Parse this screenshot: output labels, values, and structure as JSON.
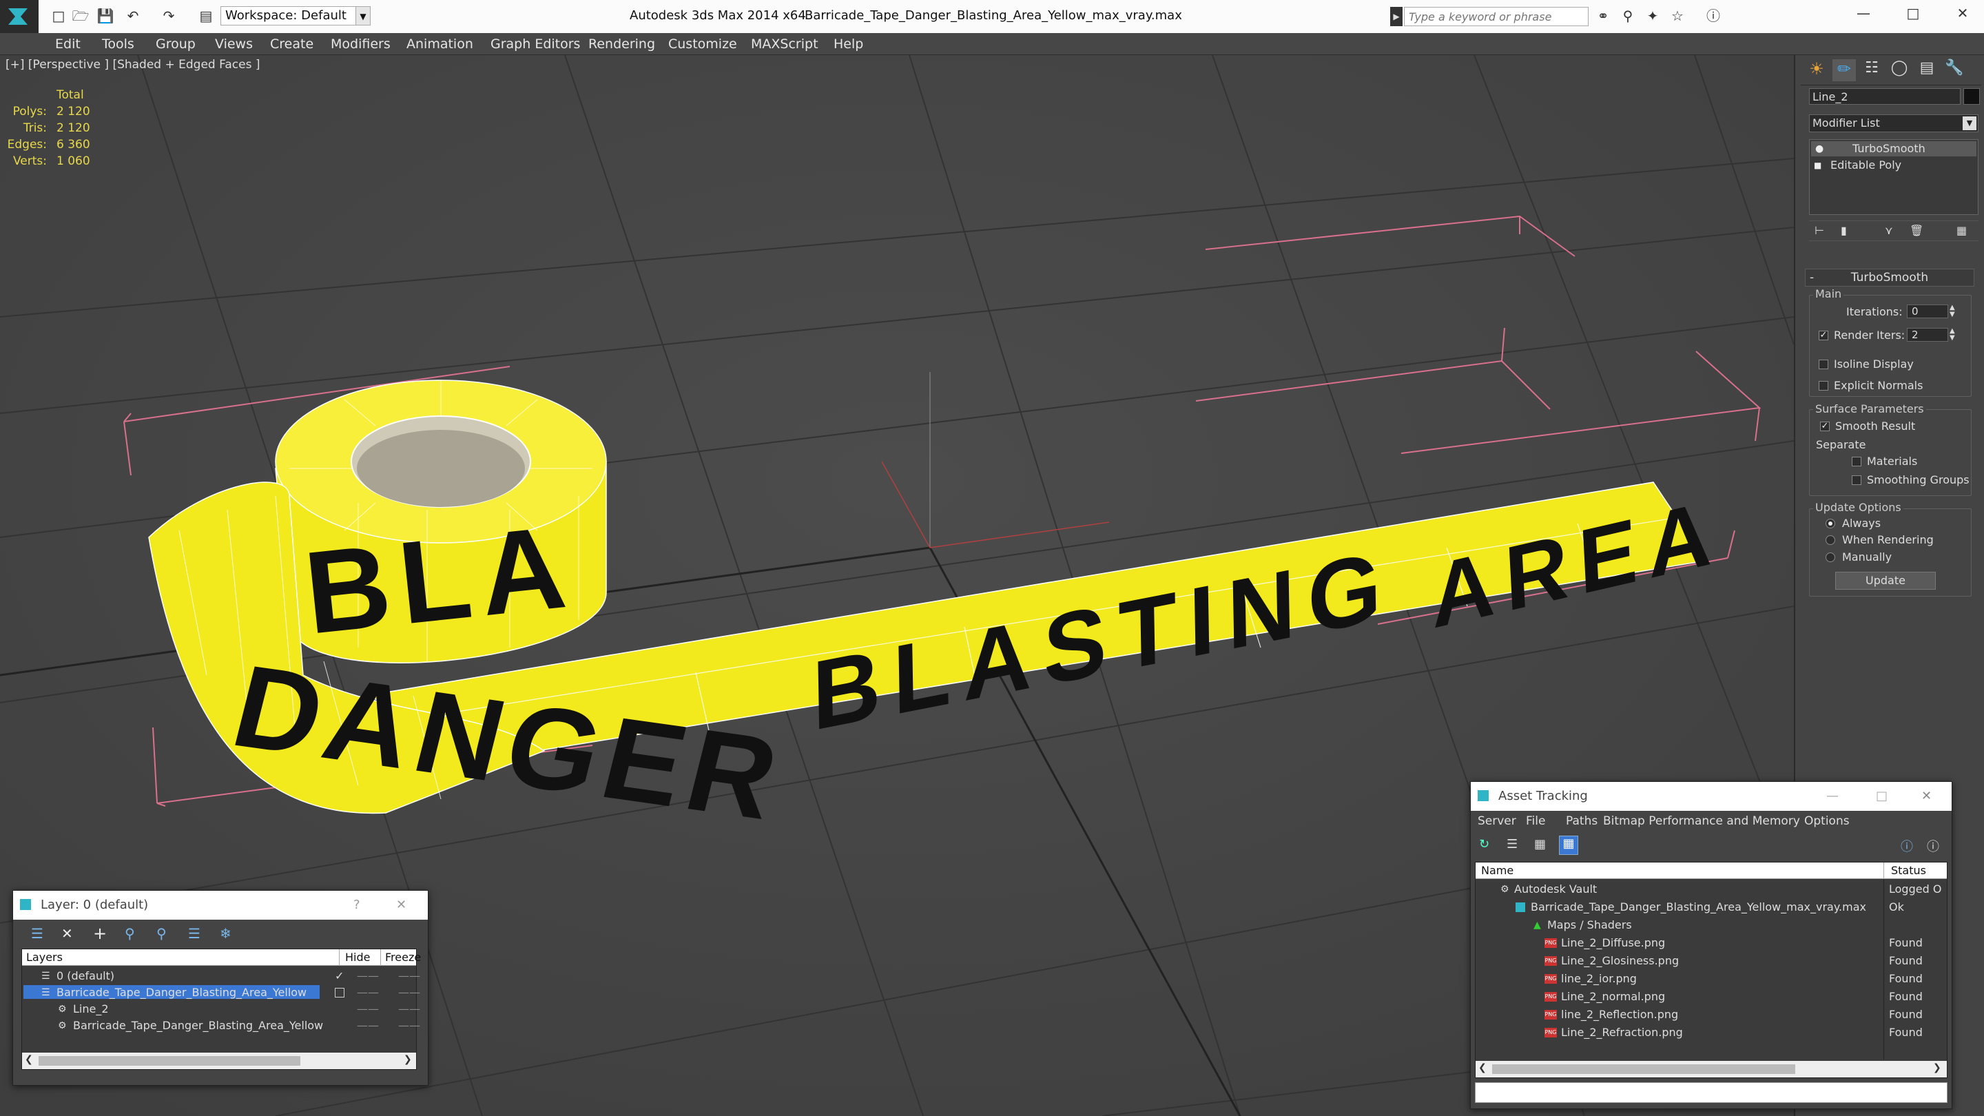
{
  "titlebar": {
    "workspace": "Workspace: Default",
    "app_title": "Autodesk 3ds Max  2014 x64",
    "file_title": "Barricade_Tape_Danger_Blasting_Area_Yellow_max_vray.max",
    "search_placeholder": "Type a keyword or phrase"
  },
  "menu": [
    "Edit",
    "Tools",
    "Group",
    "Views",
    "Create",
    "Modifiers",
    "Animation",
    "Graph Editors",
    "Rendering",
    "Customize",
    "MAXScript",
    "Help"
  ],
  "viewport": {
    "label": "[+] [Perspective ] [Shaded + Edged Faces ]",
    "stats_header": "Total",
    "stats": [
      {
        "label": "Polys:",
        "value": "2 120"
      },
      {
        "label": "Tris:",
        "value": "2 120"
      },
      {
        "label": "Edges:",
        "value": "6 360"
      },
      {
        "label": "Verts:",
        "value": "1 060"
      }
    ],
    "tape_text": [
      "DANGER",
      "BLASTING",
      "AREA"
    ],
    "roll_text": "BLA",
    "colors": {
      "tape_yellow": "#f2ea1c",
      "text_black": "#111111",
      "bbox_pink": "#d9708c",
      "grid": "#3b3b3b"
    }
  },
  "command_panel": {
    "object_name": "Line_2",
    "modifier_list": "Modifier List",
    "stack": [
      "TurboSmooth",
      "Editable Poly"
    ],
    "turbosmooth": {
      "title": "TurboSmooth",
      "main_label": "Main",
      "iterations_label": "Iterations:",
      "iterations_value": "0",
      "render_iters_label": "Render Iters:",
      "render_iters_value": "2",
      "render_iters_checked": true,
      "isoline_label": "Isoline Display",
      "explicit_normals_label": "Explicit Normals",
      "surface_label": "Surface Parameters",
      "smooth_result_label": "Smooth Result",
      "separate_label": "Separate",
      "materials_label": "Materials",
      "smoothing_groups_label": "Smoothing Groups",
      "update_options_label": "Update Options",
      "always_label": "Always",
      "when_rendering_label": "When Rendering",
      "manually_label": "Manually",
      "update_button": "Update"
    }
  },
  "layer_window": {
    "title": "Layer: 0 (default)",
    "help": "?",
    "col_layers": "Layers",
    "col_hide": "Hide",
    "col_freeze": "Freeze",
    "rows": [
      {
        "name": "0 (default)",
        "indent": 0
      },
      {
        "name": "Barricade_Tape_Danger_Blasting_Area_Yellow",
        "indent": 0
      },
      {
        "name": "Line_2",
        "indent": 1
      },
      {
        "name": "Barricade_Tape_Danger_Blasting_Area_Yellow",
        "indent": 1
      }
    ]
  },
  "asset_window": {
    "title": "Asset Tracking",
    "menu": [
      "Server",
      "File",
      "Paths",
      "Bitmap Performance and Memory",
      "Options"
    ],
    "col_name": "Name",
    "col_status": "Status",
    "rows": [
      {
        "name": "Autodesk Vault",
        "status": "Logged O",
        "level": 0
      },
      {
        "name": "Barricade_Tape_Danger_Blasting_Area_Yellow_max_vray.max",
        "status": "Ok",
        "level": 1
      },
      {
        "name": "Maps / Shaders",
        "status": "",
        "level": 2
      },
      {
        "name": "Line_2_Diffuse.png",
        "status": "Found",
        "level": 3
      },
      {
        "name": "Line_2_Glosiness.png",
        "status": "Found",
        "level": 3
      },
      {
        "name": "line_2_ior.png",
        "status": "Found",
        "level": 3
      },
      {
        "name": "Line_2_normal.png",
        "status": "Found",
        "level": 3
      },
      {
        "name": "line_2_Reflection.png",
        "status": "Found",
        "level": 3
      },
      {
        "name": "Line_2_Refraction.png",
        "status": "Found",
        "level": 3
      }
    ]
  }
}
